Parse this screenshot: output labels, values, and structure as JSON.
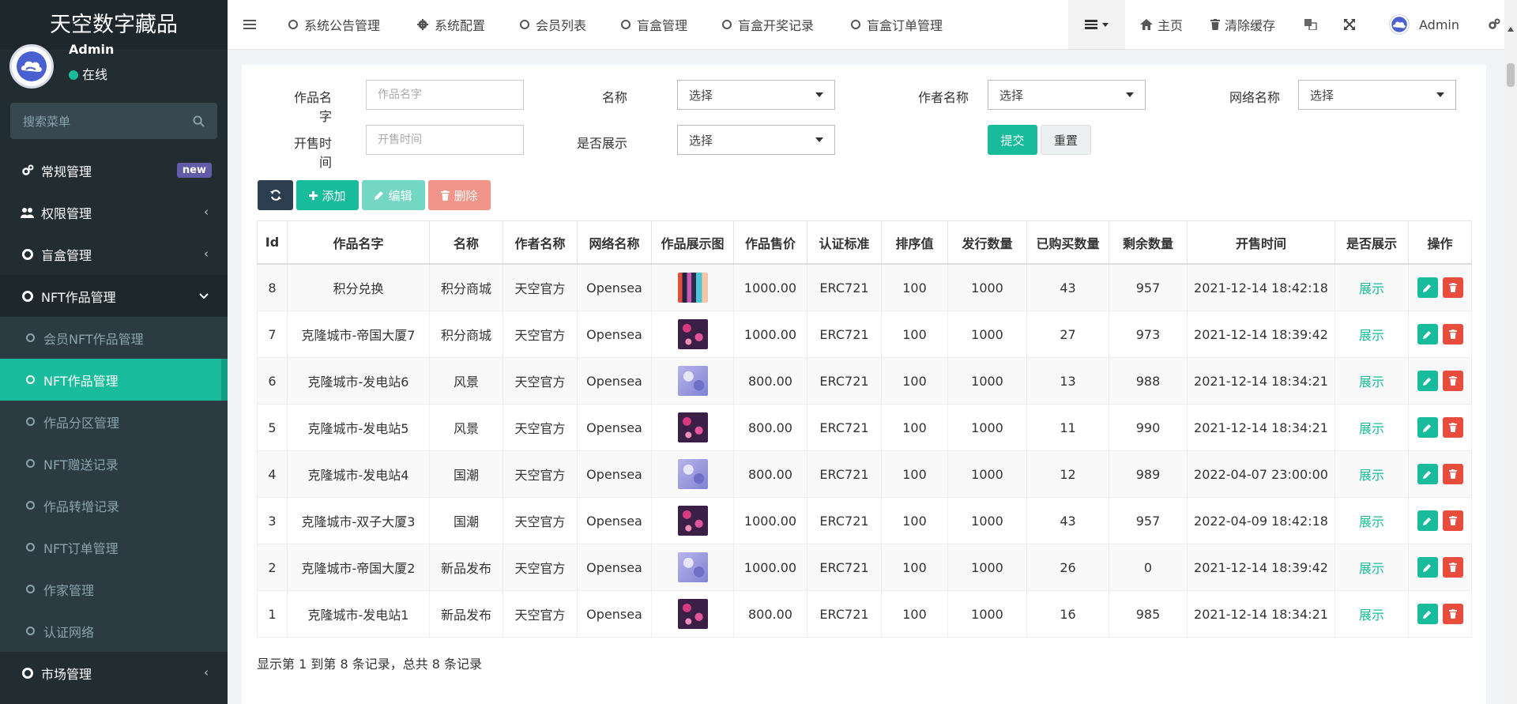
{
  "brand": "天空数字藏品",
  "user": {
    "name": "Admin",
    "status": "在线"
  },
  "sidebar": {
    "search_placeholder": "搜索菜单",
    "items": [
      {
        "label": "常规管理",
        "badge": "new",
        "icon": "cogs-icon"
      },
      {
        "label": "权限管理",
        "icon": "users-icon"
      },
      {
        "label": "盲盒管理",
        "icon": "circle-icon"
      },
      {
        "label": "NFT作品管理",
        "icon": "circle-icon"
      },
      {
        "label": "会员NFT作品管理"
      },
      {
        "label": "NFT作品管理"
      },
      {
        "label": "作品分区管理"
      },
      {
        "label": "NFT赠送记录"
      },
      {
        "label": "作品转增记录"
      },
      {
        "label": "NFT订单管理"
      },
      {
        "label": "作家管理"
      },
      {
        "label": "认证网络"
      },
      {
        "label": "市场管理",
        "icon": "circle-icon"
      }
    ]
  },
  "header": {
    "tabs": [
      {
        "label": "系统公告管理"
      },
      {
        "label": "系统配置"
      },
      {
        "label": "会员列表"
      },
      {
        "label": "盲盒管理"
      },
      {
        "label": "盲盒开奖记录"
      },
      {
        "label": "盲盒订单管理"
      }
    ],
    "home": "主页",
    "clear_cache": "清除缓存",
    "admin": "Admin"
  },
  "filters": {
    "work_name_label": "作品名字",
    "work_name_placeholder": "作品名字",
    "name_label": "名称",
    "author_label": "作者名称",
    "network_label": "网络名称",
    "sale_time_label": "开售时间",
    "sale_time_placeholder": "开售时间",
    "show_label": "是否展示",
    "select_text": "选择",
    "submit": "提交",
    "reset": "重置"
  },
  "toolbar": {
    "add": "添加",
    "edit": "编辑",
    "delete": "删除"
  },
  "table": {
    "headers": [
      "Id",
      "作品名字",
      "名称",
      "作者名称",
      "网络名称",
      "作品展示图",
      "作品售价",
      "认证标准",
      "排序值",
      "发行数量",
      "已购买数量",
      "剩余数量",
      "开售时间",
      "是否展示",
      "操作"
    ],
    "rows": [
      {
        "id": "8",
        "work": "积分兑换",
        "name": "积分商城",
        "author": "天空官方",
        "network": "Opensea",
        "thumb": "t0",
        "price": "1000.00",
        "standard": "ERC721",
        "sort": "100",
        "issued": "1000",
        "bought": "43",
        "remaining": "957",
        "time": "2021-12-14 18:42:18",
        "show": "展示"
      },
      {
        "id": "7",
        "work": "克隆城市-帝国大厦7",
        "name": "积分商城",
        "author": "天空官方",
        "network": "Opensea",
        "thumb": "t1",
        "price": "1000.00",
        "standard": "ERC721",
        "sort": "100",
        "issued": "1000",
        "bought": "27",
        "remaining": "973",
        "time": "2021-12-14 18:39:42",
        "show": "展示"
      },
      {
        "id": "6",
        "work": "克隆城市-发电站6",
        "name": "风景",
        "author": "天空官方",
        "network": "Opensea",
        "thumb": "t2",
        "price": "800.00",
        "standard": "ERC721",
        "sort": "100",
        "issued": "1000",
        "bought": "13",
        "remaining": "988",
        "time": "2021-12-14 18:34:21",
        "show": "展示"
      },
      {
        "id": "5",
        "work": "克隆城市-发电站5",
        "name": "风景",
        "author": "天空官方",
        "network": "Opensea",
        "thumb": "t1",
        "price": "800.00",
        "standard": "ERC721",
        "sort": "100",
        "issued": "1000",
        "bought": "11",
        "remaining": "990",
        "time": "2021-12-14 18:34:21",
        "show": "展示"
      },
      {
        "id": "4",
        "work": "克隆城市-发电站4",
        "name": "国潮",
        "author": "天空官方",
        "network": "Opensea",
        "thumb": "t2",
        "price": "800.00",
        "standard": "ERC721",
        "sort": "100",
        "issued": "1000",
        "bought": "12",
        "remaining": "989",
        "time": "2022-04-07 23:00:00",
        "show": "展示"
      },
      {
        "id": "3",
        "work": "克隆城市-双子大厦3",
        "name": "国潮",
        "author": "天空官方",
        "network": "Opensea",
        "thumb": "t1",
        "price": "1000.00",
        "standard": "ERC721",
        "sort": "100",
        "issued": "1000",
        "bought": "43",
        "remaining": "957",
        "time": "2022-04-09 18:42:18",
        "show": "展示"
      },
      {
        "id": "2",
        "work": "克隆城市-帝国大厦2",
        "name": "新品发布",
        "author": "天空官方",
        "network": "Opensea",
        "thumb": "t2",
        "price": "1000.00",
        "standard": "ERC721",
        "sort": "100",
        "issued": "1000",
        "bought": "26",
        "remaining": "0",
        "time": "2021-12-14 18:39:42",
        "show": "展示"
      },
      {
        "id": "1",
        "work": "克隆城市-发电站1",
        "name": "新品发布",
        "author": "天空官方",
        "network": "Opensea",
        "thumb": "t1",
        "price": "800.00",
        "standard": "ERC721",
        "sort": "100",
        "issued": "1000",
        "bought": "16",
        "remaining": "985",
        "time": "2021-12-14 18:34:21",
        "show": "展示"
      }
    ]
  },
  "pagination": {
    "info": "显示第 1 到第 8 条记录，总共 8 条记录"
  },
  "colors": {
    "accent": "#18bc9c",
    "danger": "#e74c3c",
    "sidebar": "#222d32",
    "toolbar_dark": "#2c3e50",
    "badge": "#605ca8"
  }
}
